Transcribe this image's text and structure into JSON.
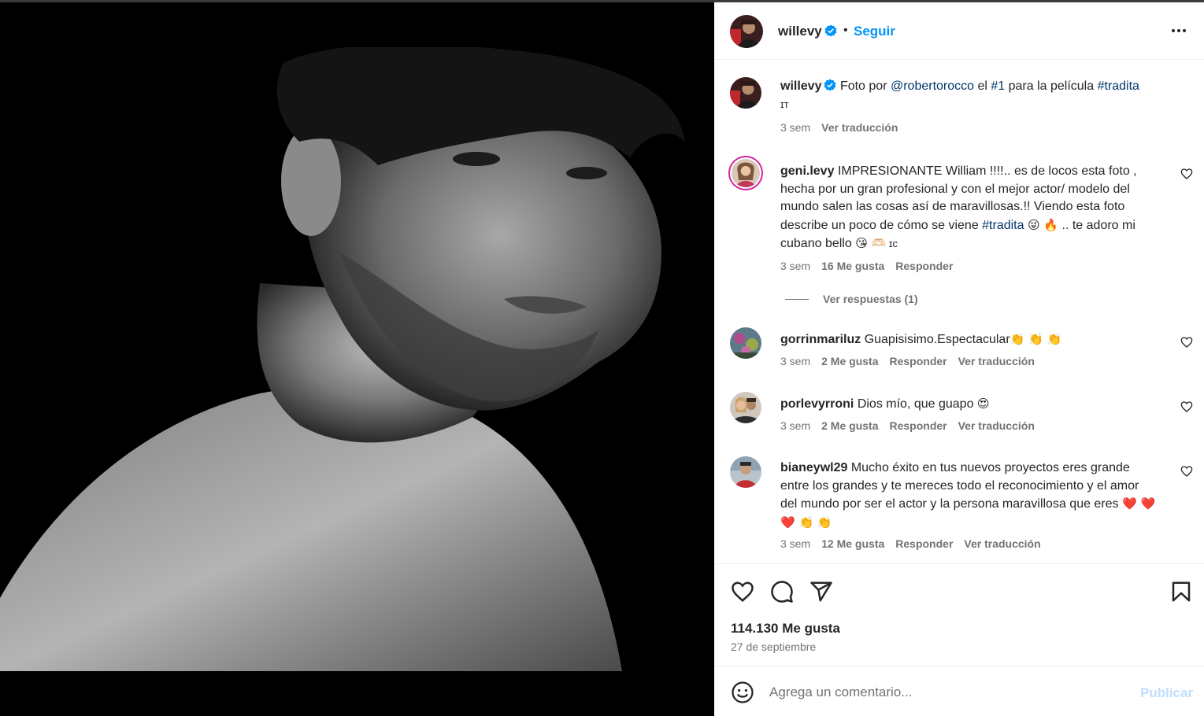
{
  "colors": {
    "accent": "#0095f6",
    "link": "#00376b",
    "muted": "#737373",
    "verified": "#0095f6",
    "publish_disabled": "#c0dffd"
  },
  "header": {
    "username": "willevy",
    "verified_icon": "verified-badge-icon",
    "separator": "•",
    "follow_label": "Seguir",
    "more_icon": "more-options-icon"
  },
  "caption": {
    "username": "willevy",
    "text_prefix": "Foto por ",
    "mention": "@robertorocco",
    "text_mid1": " el ",
    "hashtag1": "#1",
    "text_mid2": " para la película ",
    "hashtag2": "#tradita",
    "line2": "ɪт",
    "time": "3 sem",
    "translate": "Ver traducción"
  },
  "comments": [
    {
      "username": "geni.levy",
      "text_a": "IMPRESIONANTE William !!!!.. es de locos esta foto , hecha por un gran profesional y con el mejor actor/ modelo del mundo salen las cosas así de maravillosas.!! Viendo esta foto describe un poco de cómo se viene ",
      "hashtag": "#tradita",
      "emoji_a": "😜 🔥",
      "text_b": " .. te adoro mi cubano bello ",
      "emoji_b": "😘 🫶🏻",
      "text_c": " ɪc",
      "time": "3 sem",
      "likes": "16 Me gusta",
      "reply": "Responder",
      "view_replies": "Ver respuestas (1)"
    },
    {
      "username": "gorrinmariluz",
      "text": "Guapisisimo.Espectacular",
      "emoji": "👏 👏 👏",
      "time": "3 sem",
      "likes": "2 Me gusta",
      "reply": "Responder",
      "translate": "Ver traducción"
    },
    {
      "username": "porlevyrroni",
      "text": "Dios mío, que guapo ",
      "emoji": "😍",
      "time": "3 sem",
      "likes": "2 Me gusta",
      "reply": "Responder",
      "translate": "Ver traducción"
    },
    {
      "username": "bianeywl29",
      "text": "Mucho éxito en tus nuevos proyectos eres grande entre los grandes y te mereces todo el reconocimiento y el amor del mundo por ser el actor y la persona maravillosa que eres ",
      "emoji": "❤️ ❤️ ❤️ 👏 👏",
      "time": "3 sem",
      "likes": "12 Me gusta",
      "reply": "Responder",
      "translate": "Ver traducción"
    }
  ],
  "actions": {
    "like_icon": "heart-icon",
    "comment_icon": "comment-icon",
    "share_icon": "share-icon",
    "save_icon": "bookmark-icon",
    "likes_count": "114.130 Me gusta",
    "date": "27 de septiembre"
  },
  "add_comment": {
    "placeholder": "Agrega un comentario...",
    "emoji_icon": "smiley-icon",
    "publish_label": "Publicar"
  }
}
